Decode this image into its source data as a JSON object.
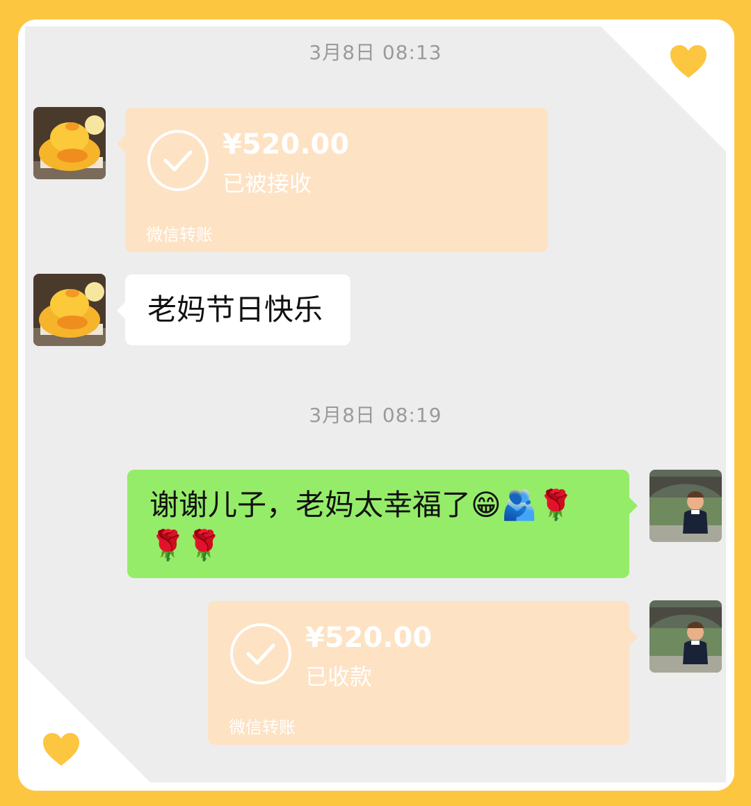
{
  "colors": {
    "frame_border": "#fdc640",
    "chat_background": "#ededed",
    "transfer_bubble": "#fde2c4",
    "sent_bubble": "#95ec69",
    "received_bubble": "#ffffff",
    "heart": "#fdc640"
  },
  "decorations": {
    "top_right": "heart-icon",
    "bottom_left": "heart-icon"
  },
  "messages": [
    {
      "type": "timestamp",
      "text": "3月8日 08:13"
    },
    {
      "type": "transfer",
      "direction": "incoming",
      "amount": "¥520.00",
      "status": "已被接收",
      "source": "微信转账",
      "avatar": "cartoon-duck-avatar"
    },
    {
      "type": "text",
      "direction": "incoming",
      "text": "老妈节日快乐",
      "avatar": "cartoon-duck-avatar"
    },
    {
      "type": "timestamp",
      "text": "3月8日 08:19"
    },
    {
      "type": "text",
      "direction": "outgoing",
      "line1": "谢谢儿子，老妈太幸福了😁🫂🌹",
      "line2": "🌹🌹",
      "avatar": "mom-photo-avatar"
    },
    {
      "type": "transfer",
      "direction": "outgoing",
      "amount": "¥520.00",
      "status": "已收款",
      "source": "微信转账",
      "avatar": "mom-photo-avatar"
    }
  ]
}
